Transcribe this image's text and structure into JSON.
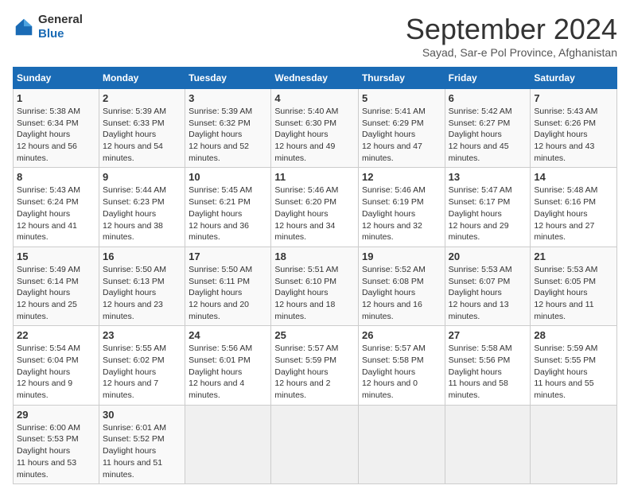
{
  "logo": {
    "general": "General",
    "blue": "Blue"
  },
  "header": {
    "month": "September 2024",
    "location": "Sayad, Sar-e Pol Province, Afghanistan"
  },
  "weekdays": [
    "Sunday",
    "Monday",
    "Tuesday",
    "Wednesday",
    "Thursday",
    "Friday",
    "Saturday"
  ],
  "weeks": [
    [
      {
        "day": 1,
        "sunrise": "5:38 AM",
        "sunset": "6:34 PM",
        "daylight": "12 hours and 56 minutes."
      },
      {
        "day": 2,
        "sunrise": "5:39 AM",
        "sunset": "6:33 PM",
        "daylight": "12 hours and 54 minutes."
      },
      {
        "day": 3,
        "sunrise": "5:39 AM",
        "sunset": "6:32 PM",
        "daylight": "12 hours and 52 minutes."
      },
      {
        "day": 4,
        "sunrise": "5:40 AM",
        "sunset": "6:30 PM",
        "daylight": "12 hours and 49 minutes."
      },
      {
        "day": 5,
        "sunrise": "5:41 AM",
        "sunset": "6:29 PM",
        "daylight": "12 hours and 47 minutes."
      },
      {
        "day": 6,
        "sunrise": "5:42 AM",
        "sunset": "6:27 PM",
        "daylight": "12 hours and 45 minutes."
      },
      {
        "day": 7,
        "sunrise": "5:43 AM",
        "sunset": "6:26 PM",
        "daylight": "12 hours and 43 minutes."
      }
    ],
    [
      {
        "day": 8,
        "sunrise": "5:43 AM",
        "sunset": "6:24 PM",
        "daylight": "12 hours and 41 minutes."
      },
      {
        "day": 9,
        "sunrise": "5:44 AM",
        "sunset": "6:23 PM",
        "daylight": "12 hours and 38 minutes."
      },
      {
        "day": 10,
        "sunrise": "5:45 AM",
        "sunset": "6:21 PM",
        "daylight": "12 hours and 36 minutes."
      },
      {
        "day": 11,
        "sunrise": "5:46 AM",
        "sunset": "6:20 PM",
        "daylight": "12 hours and 34 minutes."
      },
      {
        "day": 12,
        "sunrise": "5:46 AM",
        "sunset": "6:19 PM",
        "daylight": "12 hours and 32 minutes."
      },
      {
        "day": 13,
        "sunrise": "5:47 AM",
        "sunset": "6:17 PM",
        "daylight": "12 hours and 29 minutes."
      },
      {
        "day": 14,
        "sunrise": "5:48 AM",
        "sunset": "6:16 PM",
        "daylight": "12 hours and 27 minutes."
      }
    ],
    [
      {
        "day": 15,
        "sunrise": "5:49 AM",
        "sunset": "6:14 PM",
        "daylight": "12 hours and 25 minutes."
      },
      {
        "day": 16,
        "sunrise": "5:50 AM",
        "sunset": "6:13 PM",
        "daylight": "12 hours and 23 minutes."
      },
      {
        "day": 17,
        "sunrise": "5:50 AM",
        "sunset": "6:11 PM",
        "daylight": "12 hours and 20 minutes."
      },
      {
        "day": 18,
        "sunrise": "5:51 AM",
        "sunset": "6:10 PM",
        "daylight": "12 hours and 18 minutes."
      },
      {
        "day": 19,
        "sunrise": "5:52 AM",
        "sunset": "6:08 PM",
        "daylight": "12 hours and 16 minutes."
      },
      {
        "day": 20,
        "sunrise": "5:53 AM",
        "sunset": "6:07 PM",
        "daylight": "12 hours and 13 minutes."
      },
      {
        "day": 21,
        "sunrise": "5:53 AM",
        "sunset": "6:05 PM",
        "daylight": "12 hours and 11 minutes."
      }
    ],
    [
      {
        "day": 22,
        "sunrise": "5:54 AM",
        "sunset": "6:04 PM",
        "daylight": "12 hours and 9 minutes."
      },
      {
        "day": 23,
        "sunrise": "5:55 AM",
        "sunset": "6:02 PM",
        "daylight": "12 hours and 7 minutes."
      },
      {
        "day": 24,
        "sunrise": "5:56 AM",
        "sunset": "6:01 PM",
        "daylight": "12 hours and 4 minutes."
      },
      {
        "day": 25,
        "sunrise": "5:57 AM",
        "sunset": "5:59 PM",
        "daylight": "12 hours and 2 minutes."
      },
      {
        "day": 26,
        "sunrise": "5:57 AM",
        "sunset": "5:58 PM",
        "daylight": "12 hours and 0 minutes."
      },
      {
        "day": 27,
        "sunrise": "5:58 AM",
        "sunset": "5:56 PM",
        "daylight": "11 hours and 58 minutes."
      },
      {
        "day": 28,
        "sunrise": "5:59 AM",
        "sunset": "5:55 PM",
        "daylight": "11 hours and 55 minutes."
      }
    ],
    [
      {
        "day": 29,
        "sunrise": "6:00 AM",
        "sunset": "5:53 PM",
        "daylight": "11 hours and 53 minutes."
      },
      {
        "day": 30,
        "sunrise": "6:01 AM",
        "sunset": "5:52 PM",
        "daylight": "11 hours and 51 minutes."
      },
      null,
      null,
      null,
      null,
      null
    ]
  ]
}
